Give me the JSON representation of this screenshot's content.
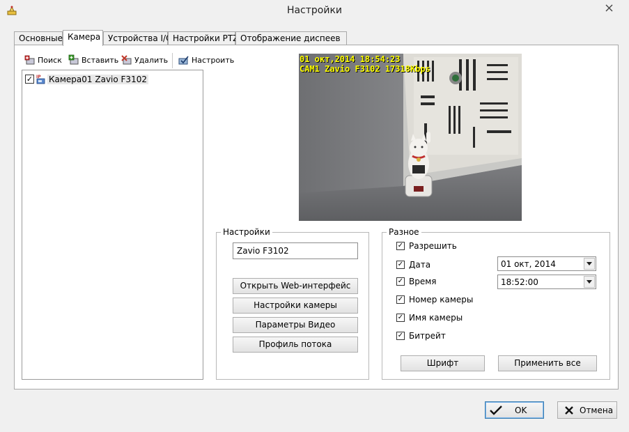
{
  "window": {
    "title": "Настройки"
  },
  "tabs": [
    {
      "label": "Основные"
    },
    {
      "label": "Камера"
    },
    {
      "label": "Устройства I/O"
    },
    {
      "label": "Настройки PTZ"
    },
    {
      "label": "Отображение диспеев"
    }
  ],
  "toolbar": {
    "search": "Поиск",
    "insert": "Вставить",
    "delete": "Удалить",
    "configure": "Настроить"
  },
  "camera_list": [
    {
      "label": "Камера01 Zavio F3102",
      "checked": true,
      "icon": "ip-camera-icon"
    }
  ],
  "preview": {
    "osd_line1": "01 окт,2014 18:54:23",
    "osd_line2": "CAM1 Zavio F3102 17318Kbps"
  },
  "settings": {
    "title": "Настройки",
    "camera_name": "Zavio F3102",
    "open_web": "Открыть Web-интерфейс",
    "camera_settings": "Настройки камеры",
    "video_params": "Параметры Видео",
    "stream_profile": "Профиль потока"
  },
  "misc": {
    "title": "Разное",
    "enable": "Разрешить",
    "date": "Дата",
    "time": "Время",
    "camera_number": "Номер камеры",
    "camera_name": "Имя камеры",
    "bitrate": "Битрейт",
    "date_value": "01 окт, 2014",
    "time_value": "18:52:00",
    "font_button": "Шрифт",
    "apply_all_button": "Применить все"
  },
  "footer": {
    "ok": "OK",
    "cancel": "Отмена"
  },
  "colors": {
    "osd_text": "#ffff00",
    "accent_border": "#3c7fb1",
    "delete_red": "#c0392b",
    "insert_green": "#3a9a2a"
  }
}
